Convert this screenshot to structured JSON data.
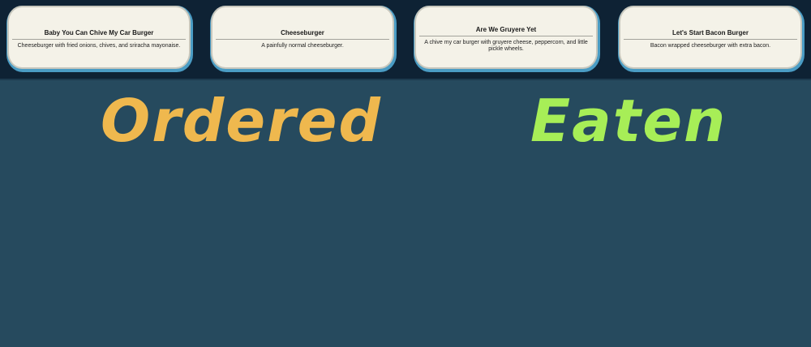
{
  "menu": [
    {
      "title": "Baby You Can Chive My Car Burger",
      "description": "Cheeseburger with fried onions, chives, and sriracha mayonaise."
    },
    {
      "title": "Cheeseburger",
      "description": "A painfully normal cheeseburger."
    },
    {
      "title": "Are We Gruyere Yet",
      "description": "A chive my car burger with gruyere cheese, peppercorn, and little pickle wheels."
    },
    {
      "title": "Let's Start Bacon Burger",
      "description": "Bacon wrapped cheeseburger with extra bacon."
    }
  ],
  "columns": {
    "ordered": "Ordered",
    "eaten": "Eaten"
  },
  "colors": {
    "background": "#264a5e",
    "menu_bar": "#0e2234",
    "card": "#f4f2e8",
    "ordered": "#efb84e",
    "eaten": "#a7ee57"
  }
}
